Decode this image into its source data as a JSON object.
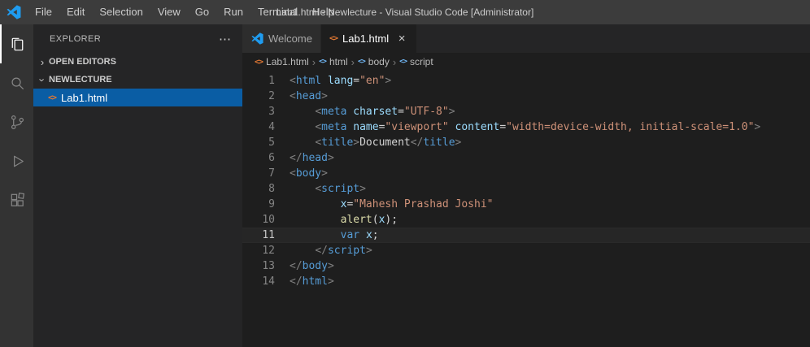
{
  "glyphs": {
    "chevron": "›",
    "html_icon": "<>",
    "symbol_icon": "<>",
    "close": "×",
    "more_actions": "⋯",
    "breadcrumb_separator": "›"
  },
  "colors": {
    "selection_blue": "#0a5da4",
    "logo_blue": "#1f9cf0",
    "html_icon_orange": "#e37933",
    "tag_blue": "#569cd6",
    "attr_lightblue": "#9cdcfe",
    "string_orange": "#ce9178",
    "function_yellow": "#dcdcaa",
    "titlebar_bg": "#3c3c3c",
    "activitybar_bg": "#333333",
    "sidebar_bg": "#252526",
    "editor_bg": "#1e1e1e"
  },
  "title_bar": {
    "title": "Lab1.html - Newlecture - Visual Studio Code [Administrator]",
    "menus": [
      "File",
      "Edit",
      "Selection",
      "View",
      "Go",
      "Run",
      "Terminal",
      "Help"
    ]
  },
  "activity_bar": {
    "items": [
      {
        "icon": "files-icon",
        "active": true
      },
      {
        "icon": "search-icon",
        "active": false
      },
      {
        "icon": "source-control-icon",
        "active": false
      },
      {
        "icon": "run-debug-icon",
        "active": false
      },
      {
        "icon": "extensions-icon",
        "active": false
      }
    ]
  },
  "sidebar": {
    "title": "EXPLORER",
    "open_editors_label": "OPEN EDITORS",
    "folder_label": "NEWLECTURE",
    "files": [
      {
        "name": "Lab1.html",
        "selected": true
      }
    ]
  },
  "editor_tabs": [
    {
      "label": "Welcome",
      "active": false
    },
    {
      "label": "Lab1.html",
      "active": true,
      "close": "×"
    }
  ],
  "breadcrumb": {
    "items": [
      {
        "label": "Lab1.html",
        "icon": "html-file-icon"
      },
      {
        "label": "html",
        "icon": "symbol-icon"
      },
      {
        "label": "body",
        "icon": "symbol-icon"
      },
      {
        "label": "script",
        "icon": "symbol-icon"
      }
    ]
  },
  "editor": {
    "language": "html",
    "active_line": 11,
    "lines": [
      {
        "n": 1,
        "tokens": [
          [
            "<",
            "p"
          ],
          [
            "html",
            "t"
          ],
          [
            " ",
            "f"
          ],
          [
            "lang",
            "a"
          ],
          [
            "=",
            "f"
          ],
          [
            "\"en\"",
            "s"
          ],
          [
            ">",
            "p"
          ]
        ]
      },
      {
        "n": 2,
        "tokens": [
          [
            "<",
            "p"
          ],
          [
            "head",
            "t"
          ],
          [
            ">",
            "p"
          ]
        ]
      },
      {
        "n": 3,
        "tokens": [
          [
            "    ",
            "f"
          ],
          [
            "<",
            "p"
          ],
          [
            "meta",
            "t"
          ],
          [
            " ",
            "f"
          ],
          [
            "charset",
            "a"
          ],
          [
            "=",
            "f"
          ],
          [
            "\"UTF-8\"",
            "s"
          ],
          [
            ">",
            "p"
          ]
        ]
      },
      {
        "n": 4,
        "tokens": [
          [
            "    ",
            "f"
          ],
          [
            "<",
            "p"
          ],
          [
            "meta",
            "t"
          ],
          [
            " ",
            "f"
          ],
          [
            "name",
            "a"
          ],
          [
            "=",
            "f"
          ],
          [
            "\"viewport\"",
            "s"
          ],
          [
            " ",
            "f"
          ],
          [
            "content",
            "a"
          ],
          [
            "=",
            "f"
          ],
          [
            "\"width=device-width, initial-scale=1.0\"",
            "s"
          ],
          [
            ">",
            "p"
          ]
        ]
      },
      {
        "n": 5,
        "tokens": [
          [
            "    ",
            "f"
          ],
          [
            "<",
            "p"
          ],
          [
            "title",
            "t"
          ],
          [
            ">",
            "p"
          ],
          [
            "Document",
            "f"
          ],
          [
            "</",
            "p"
          ],
          [
            "title",
            "t"
          ],
          [
            ">",
            "p"
          ]
        ]
      },
      {
        "n": 6,
        "tokens": [
          [
            "</",
            "p"
          ],
          [
            "head",
            "t"
          ],
          [
            ">",
            "p"
          ]
        ]
      },
      {
        "n": 7,
        "tokens": [
          [
            "<",
            "p"
          ],
          [
            "body",
            "t"
          ],
          [
            ">",
            "p"
          ]
        ]
      },
      {
        "n": 8,
        "tokens": [
          [
            "    ",
            "f"
          ],
          [
            "<",
            "p"
          ],
          [
            "script",
            "t"
          ],
          [
            ">",
            "p"
          ]
        ]
      },
      {
        "n": 9,
        "tokens": [
          [
            "        ",
            "f"
          ],
          [
            "x",
            "v"
          ],
          [
            "=",
            "f"
          ],
          [
            "\"Mahesh Prashad Joshi\"",
            "s"
          ]
        ]
      },
      {
        "n": 10,
        "tokens": [
          [
            "        ",
            "f"
          ],
          [
            "alert",
            "fn"
          ],
          [
            "(",
            "f"
          ],
          [
            "x",
            "v"
          ],
          [
            ")",
            "f"
          ],
          [
            ";",
            "f"
          ]
        ]
      },
      {
        "n": 11,
        "tokens": [
          [
            "        ",
            "f"
          ],
          [
            "var",
            "k"
          ],
          [
            " ",
            "f"
          ],
          [
            "x",
            "v"
          ],
          [
            ";",
            "f"
          ]
        ]
      },
      {
        "n": 12,
        "tokens": [
          [
            "    ",
            "f"
          ],
          [
            "</",
            "p"
          ],
          [
            "script",
            "t"
          ],
          [
            ">",
            "p"
          ]
        ]
      },
      {
        "n": 13,
        "tokens": [
          [
            "</",
            "p"
          ],
          [
            "body",
            "t"
          ],
          [
            ">",
            "p"
          ]
        ]
      },
      {
        "n": 14,
        "tokens": [
          [
            "</",
            "p"
          ],
          [
            "html",
            "t"
          ],
          [
            ">",
            "p"
          ]
        ]
      }
    ]
  }
}
